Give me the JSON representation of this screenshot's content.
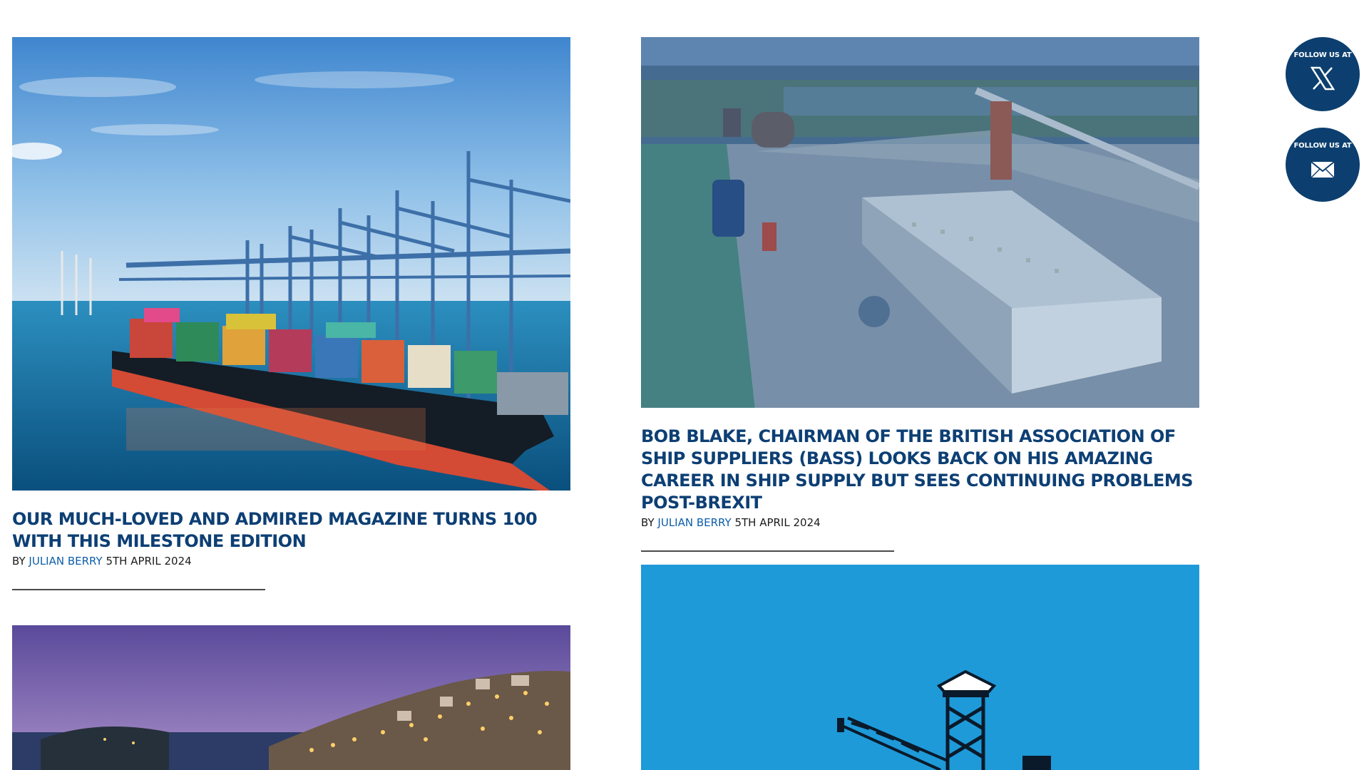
{
  "articles": [
    {
      "title": "Our much-loved and admired magazine turns 100 with this milestone edition",
      "by": "By",
      "author": "Julian Berry",
      "date": "5th April 2024",
      "image": "container-ship-at-port-cranes"
    },
    {
      "title": "Bob Blake, Chairman of the British Association of Ship Suppliers (BASS) looks back on his amazing career in ship supply but sees continuing problems post-Brexit",
      "by": "By",
      "author": "Julian Berry",
      "date": "5th April 2024",
      "image": "aerial-port-warehouse"
    },
    {
      "image": "coastal-town-at-dusk"
    },
    {
      "image": "offshore-rig-illustration"
    }
  ],
  "social": {
    "x": {
      "label": "Follow us at",
      "icon": "x-logo-icon"
    },
    "email": {
      "label": "Follow us at",
      "icon": "envelope-icon"
    }
  },
  "colors": {
    "title": "#0d3f74",
    "author_link": "#0d5ea8",
    "follow_bg": "#0c3f6f",
    "rig_bg": "#1e9ad9"
  }
}
